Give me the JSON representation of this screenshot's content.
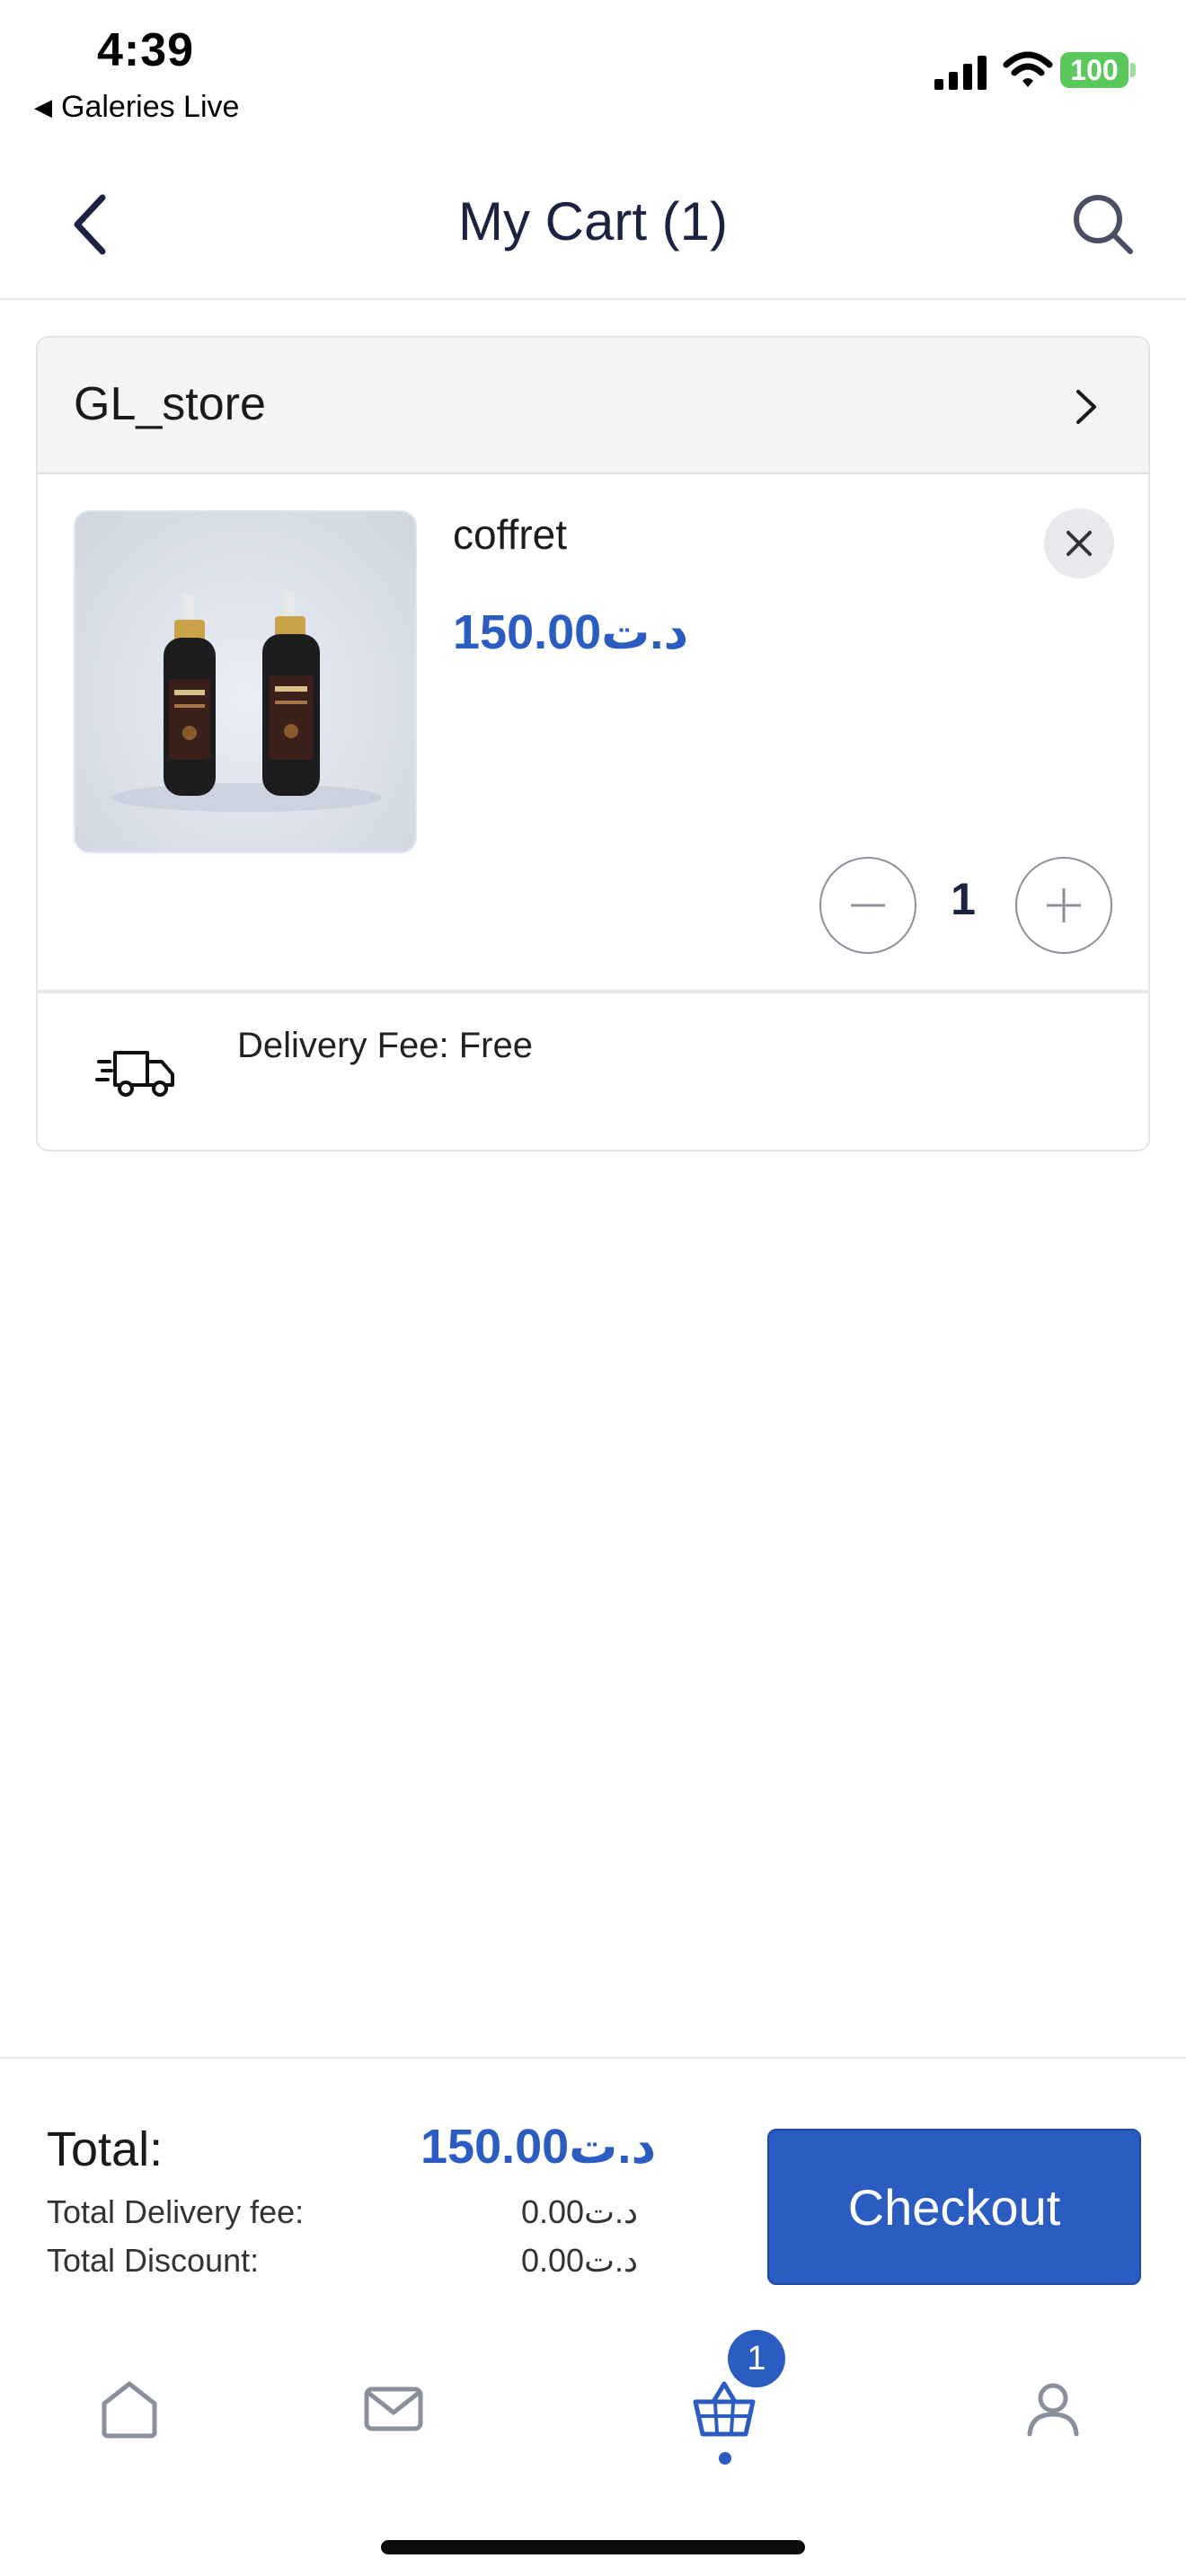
{
  "status_bar": {
    "time": "4:39",
    "back_app": "Galeries Live",
    "battery": "100"
  },
  "nav": {
    "title": "My Cart (1)",
    "back_icon": "chevron-left-icon",
    "search_icon": "search-icon"
  },
  "store": {
    "name": "GL_store",
    "product": {
      "name": "coffret",
      "price": "150.00د.ت",
      "quantity": "1"
    },
    "delivery_text": "Delivery Fee: Free"
  },
  "summary": {
    "total_label": "Total:",
    "total_value": "150.00د.ت",
    "delivery_fee_label": "Total Delivery fee:",
    "delivery_fee_value": "0.00د.ت",
    "discount_label": "Total Discount:",
    "discount_value": "0.00د.ت",
    "checkout_label": "Checkout"
  },
  "tabbar": {
    "items": [
      "home-icon",
      "mail-icon",
      "cart-icon",
      "user-icon"
    ],
    "cart_badge": "1",
    "active": "cart"
  },
  "colors": {
    "accent": "#2b5cc2",
    "battery": "#5ac85a",
    "store_header_bg": "#f3f4f6"
  }
}
